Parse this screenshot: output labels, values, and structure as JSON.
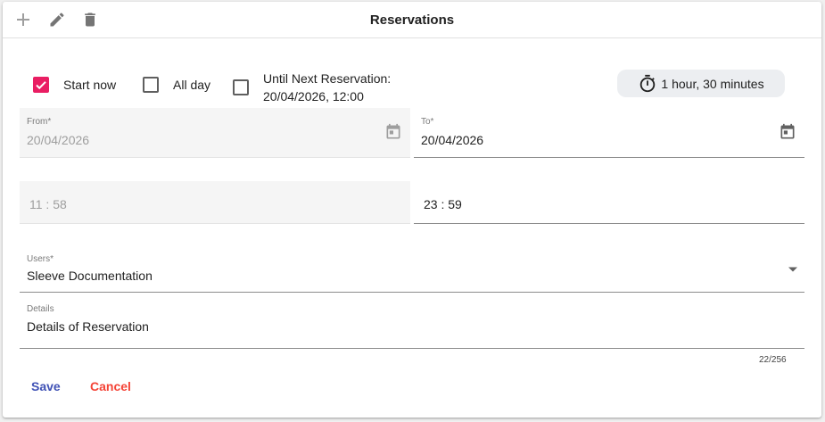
{
  "header": {
    "title": "Reservations",
    "icons": [
      "add-icon",
      "edit-icon",
      "delete-icon"
    ]
  },
  "options": {
    "start_now": {
      "label": "Start now",
      "checked": true
    },
    "all_day": {
      "label": "All day",
      "checked": false
    },
    "until_next": {
      "label_line1": "Until Next Reservation:",
      "label_line2": "20/04/2026, 12:00",
      "checked": false
    }
  },
  "duration": {
    "icon": "timer-icon",
    "text": "1 hour, 30 minutes"
  },
  "from": {
    "label": "From*",
    "date": "20/04/2026",
    "time": "11 : 58"
  },
  "to": {
    "label": "To*",
    "date": "20/04/2026",
    "time": "23 : 59"
  },
  "users": {
    "label": "Users*",
    "value": "Sleeve Documentation"
  },
  "details": {
    "label": "Details",
    "value": "Details of Reservation",
    "counter": "22/256"
  },
  "actions": {
    "save": "Save",
    "cancel": "Cancel"
  },
  "colors": {
    "accent_pink": "#e91e63",
    "save_blue": "#3f51b5",
    "cancel_red": "#f44336",
    "icon_gray": "#757575"
  }
}
